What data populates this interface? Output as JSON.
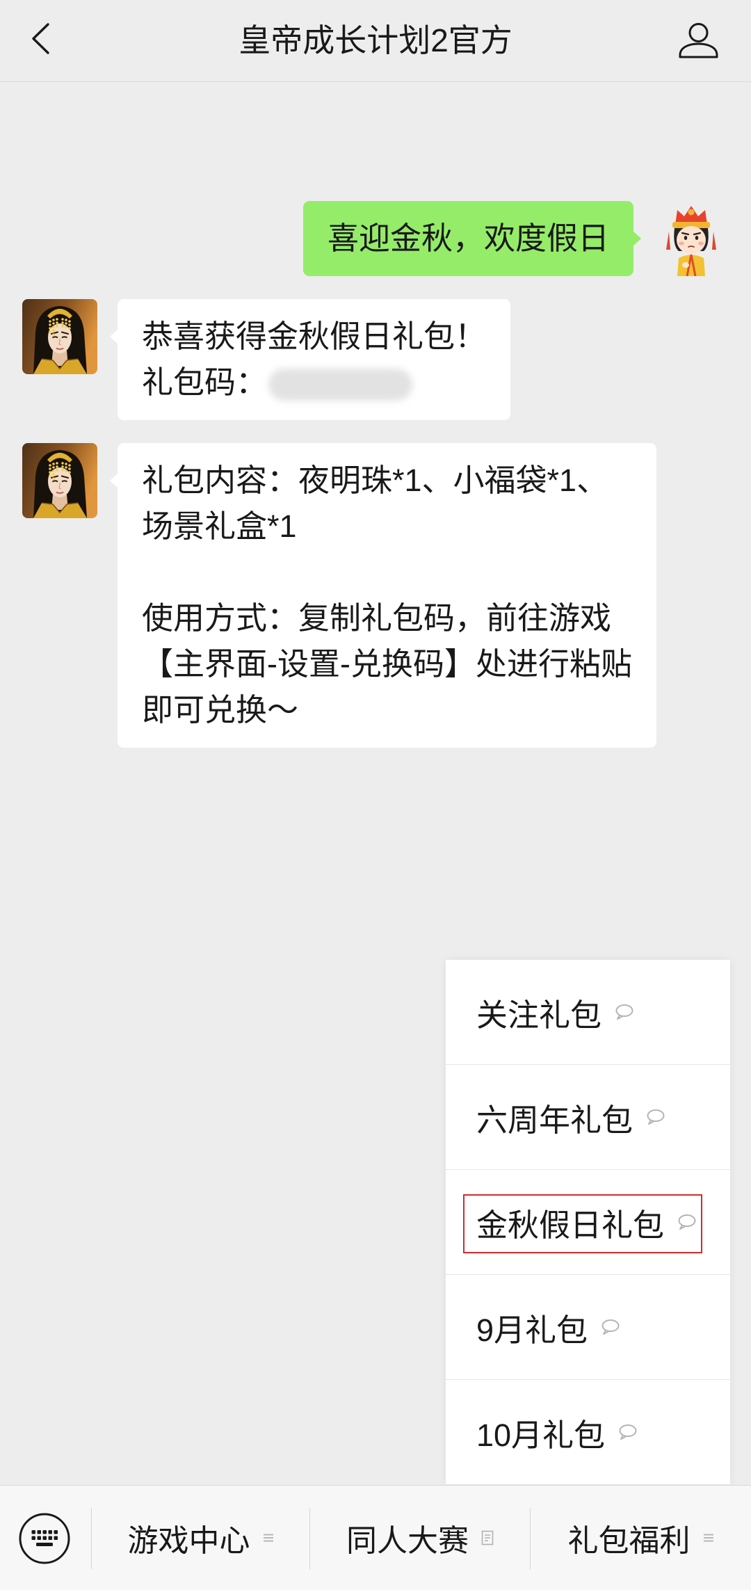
{
  "header": {
    "title": "皇帝成长计划2官方",
    "back_icon": "chevron-left-icon",
    "profile_icon": "person-icon"
  },
  "chat": {
    "outgoing_message": {
      "avatar_icon": "cartoon-emperor-avatar",
      "lines": [
        "喜迎金秋，欢度假日"
      ]
    },
    "incoming_messages": [
      {
        "avatar_icon": "game-character-avatar",
        "lines": [
          "恭喜获得金秋假日礼包！",
          "礼包码："
        ],
        "gift_code_redacted": true
      },
      {
        "avatar_icon": "game-character-avatar",
        "paragraphs": [
          [
            "礼包内容：夜明珠*1、小福袋*1、",
            "场景礼盒*1"
          ],
          [
            "使用方式：复制礼包码，前往游戏",
            "【主界面-设置-兑换码】处进行粘贴",
            "即可兑换～"
          ]
        ]
      }
    ]
  },
  "submenu": {
    "items": [
      {
        "label": "关注礼包",
        "icon": "chat-bubble-icon",
        "highlighted": false
      },
      {
        "label": "六周年礼包",
        "icon": "chat-bubble-icon",
        "highlighted": false
      },
      {
        "label": "金秋假日礼包",
        "icon": "chat-bubble-icon",
        "highlighted": true
      },
      {
        "label": "9月礼包",
        "icon": "chat-bubble-icon",
        "highlighted": false
      },
      {
        "label": "10月礼包",
        "icon": "chat-bubble-icon",
        "highlighted": false
      }
    ]
  },
  "bottom_menu": {
    "keyboard_icon": "keyboard-icon",
    "items": [
      {
        "label": "游戏中心",
        "icon": "menu-lines-icon"
      },
      {
        "label": "同人大赛",
        "icon": "document-icon"
      },
      {
        "label": "礼包福利",
        "icon": "menu-lines-icon"
      }
    ]
  },
  "colors": {
    "background": "#ededed",
    "outgoing_bubble": "#95ec69",
    "incoming_bubble": "#ffffff",
    "text": "#191919",
    "highlight_border": "#d42a2a",
    "bottom_bar": "#f7f7f7"
  }
}
